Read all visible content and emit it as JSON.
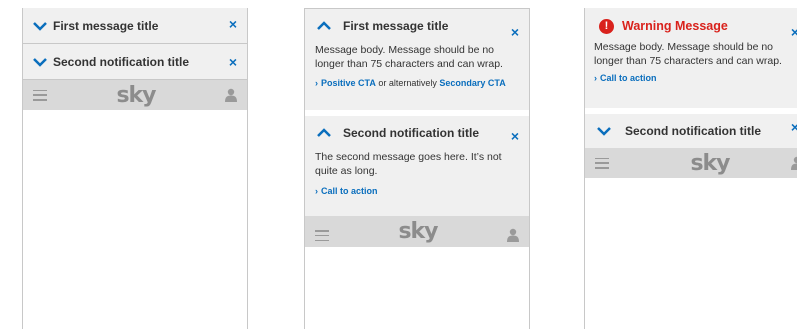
{
  "icons": {
    "chevron_down": "chevron-down-icon",
    "chevron_up": "chevron-up-icon",
    "close": "close-icon",
    "menu": "hamburger-menu-icon",
    "user": "user-icon",
    "warning": "warning-icon"
  },
  "colors": {
    "accent_blue": "#0a6ebd",
    "warning_red": "#d9221c",
    "notification_bg": "#f0f0f0",
    "navbar_bg": "#d9d9d9"
  },
  "close_label": "×",
  "logo": "sky",
  "screen1": {
    "notifications": [
      {
        "title": "First message title"
      },
      {
        "title": "Second notification title"
      }
    ]
  },
  "screen2": {
    "first": {
      "title": "First message title",
      "body": "Message body. Message should be no longer than 75 characters and can wrap.",
      "cta_primary": "Positive CTA",
      "cta_connector": "or alternatively",
      "cta_secondary": "Secondary CTA"
    },
    "second": {
      "title": "Second notification title",
      "body": "The second message goes here. It’s not quite as long.",
      "cta": "Call to action"
    }
  },
  "screen3": {
    "warning": {
      "icon_glyph": "!",
      "title": "Warning Message",
      "body": "Message body. Message should be no longer than 75 characters and can wrap.",
      "cta": "Call to action"
    },
    "second": {
      "title": "Second notification title"
    }
  }
}
